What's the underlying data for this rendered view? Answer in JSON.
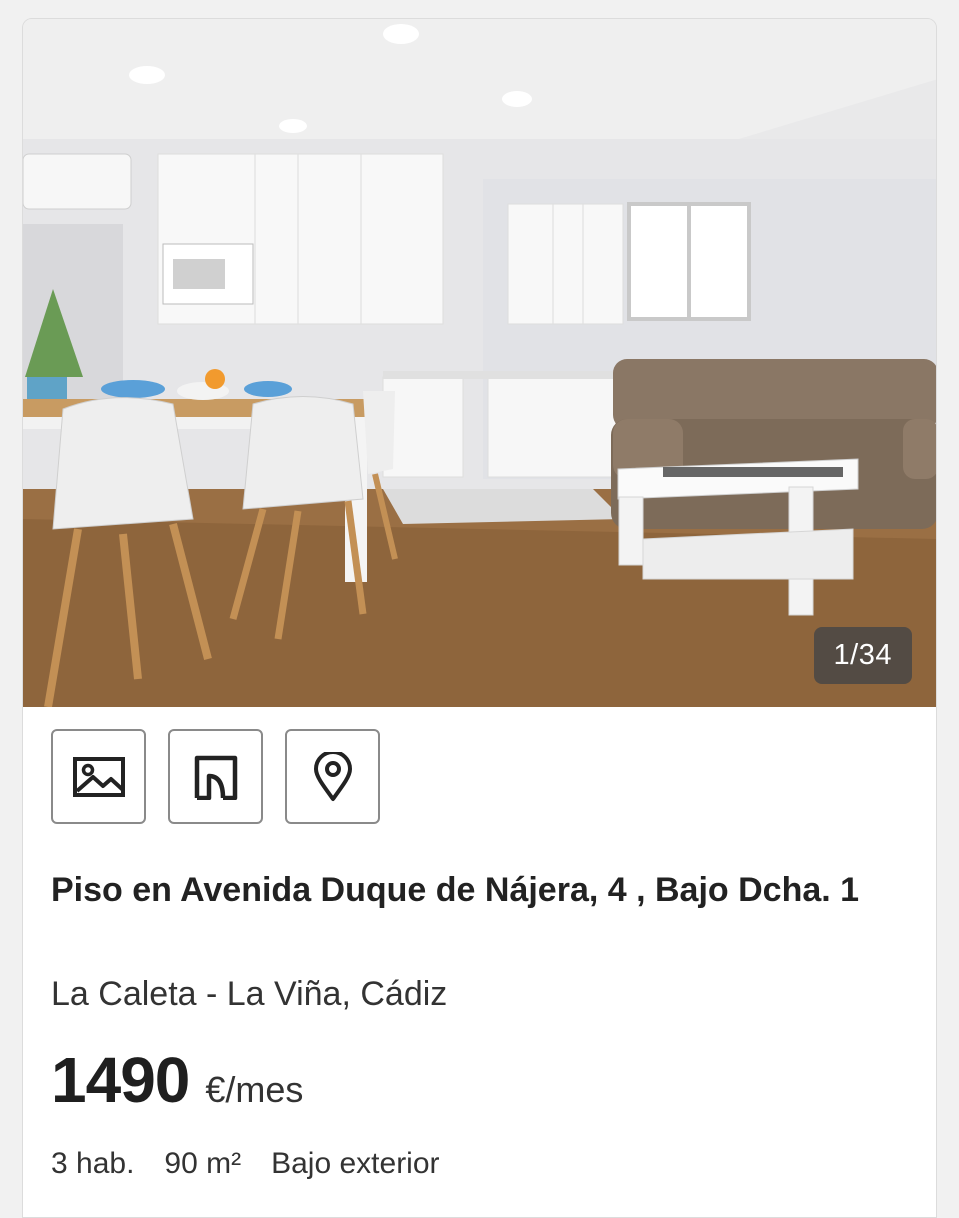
{
  "listing": {
    "photo": {
      "counter": "1/34"
    },
    "actions": [
      {
        "name": "photos-button",
        "icon": "image-icon"
      },
      {
        "name": "floorplan-button",
        "icon": "floorplan-icon"
      },
      {
        "name": "map-button",
        "icon": "map-pin-icon"
      }
    ],
    "title": "Piso en Avenida Duque de Nájera, 4 , Bajo Dcha. 1",
    "location": "La Caleta - La Viña, Cádiz",
    "price": "1490",
    "price_unit": "€/mes",
    "features": {
      "rooms": "3 hab.",
      "area": "90 m²",
      "floor": "Bajo exterior"
    }
  }
}
